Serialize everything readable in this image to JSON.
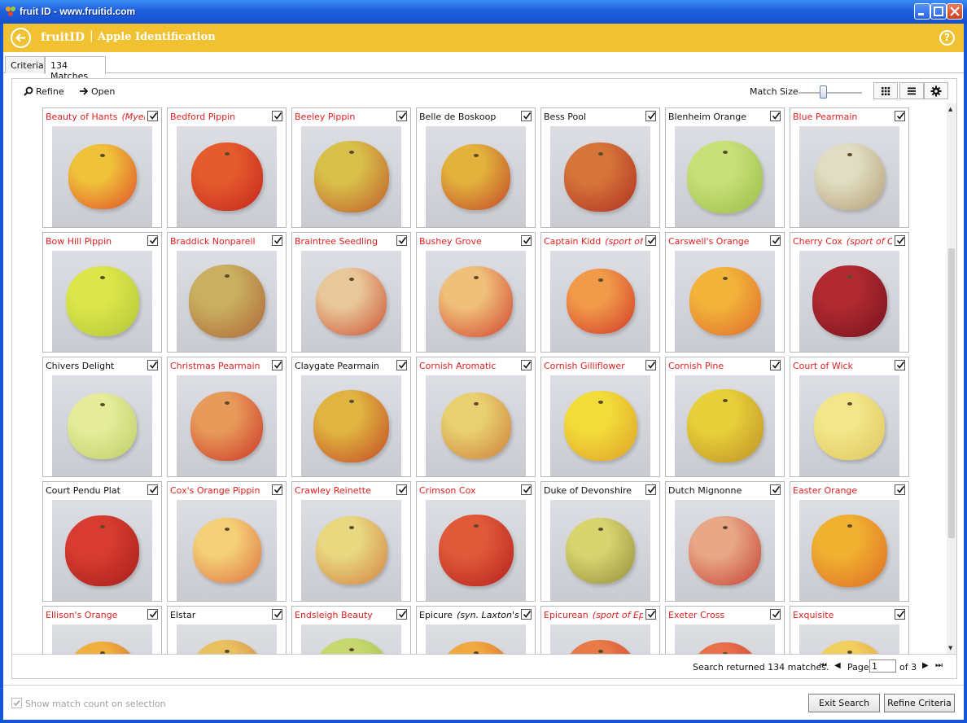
{
  "window": {
    "title": "fruit ID - www.fruitid.com",
    "min_icon": "minimize-icon",
    "max_icon": "maximize-icon",
    "close_icon": "close-icon"
  },
  "header": {
    "brand": "fruitID",
    "separator": "|",
    "subtitle": "Apple Identification",
    "help": "?",
    "back_icon": "back-arrow-icon"
  },
  "tabs": [
    {
      "label": "Criteria",
      "active": false
    },
    {
      "label": "134 Matches",
      "active": true
    }
  ],
  "toolbar": {
    "refine_label": "Refine",
    "open_label": "Open",
    "match_size_label": "Match Size",
    "match_size_level": 0.33,
    "view_icons": [
      "grid-view-icon",
      "list-view-icon",
      "settings-icon"
    ]
  },
  "colors": {
    "banner": "#f0c232",
    "match_red": "#e02020",
    "title_blue": "#1f5fdc"
  },
  "cards": [
    {
      "name": "Beauty of Hants",
      "note": "(Myers)",
      "red": true,
      "checked": true,
      "apple": [
        "#f0c23a",
        "#e0552a"
      ]
    },
    {
      "name": "Bedford Pippin",
      "note": "",
      "red": true,
      "checked": true,
      "apple": [
        "#e45c2d",
        "#c8281f"
      ]
    },
    {
      "name": "Beeley Pippin",
      "note": "",
      "red": true,
      "checked": true,
      "apple": [
        "#d8c04a",
        "#c2622e"
      ]
    },
    {
      "name": "Belle de Boskoop",
      "note": "",
      "red": false,
      "checked": true,
      "apple": [
        "#e2b23c",
        "#c44e2a"
      ]
    },
    {
      "name": "Bess Pool",
      "note": "",
      "red": false,
      "checked": true,
      "apple": [
        "#d6753a",
        "#b23424"
      ]
    },
    {
      "name": "Blenheim Orange",
      "note": "",
      "red": false,
      "checked": true,
      "apple": [
        "#c9e07a",
        "#9cc04a"
      ]
    },
    {
      "name": "Blue Pearmain",
      "note": "",
      "red": true,
      "checked": true,
      "apple": [
        "#e0ddc2",
        "#b8a37a"
      ]
    },
    {
      "name": "Bow Hill Pippin",
      "note": "",
      "red": true,
      "checked": true,
      "apple": [
        "#dce64a",
        "#b4c83a"
      ]
    },
    {
      "name": "Braddick Nonpareil",
      "note": "",
      "red": true,
      "checked": true,
      "apple": [
        "#c9b060",
        "#b06a3a"
      ]
    },
    {
      "name": "Braintree Seedling",
      "note": "",
      "red": true,
      "checked": true,
      "apple": [
        "#e8c89a",
        "#cf5a3a"
      ]
    },
    {
      "name": "Bushey Grove",
      "note": "",
      "red": true,
      "checked": true,
      "apple": [
        "#efc07a",
        "#d44a34"
      ]
    },
    {
      "name": "Captain Kidd",
      "note": "(sport of Kidd's O",
      "red": true,
      "checked": true,
      "apple": [
        "#f09a4a",
        "#d4402a"
      ]
    },
    {
      "name": "Carswell's Orange",
      "note": "",
      "red": true,
      "checked": true,
      "apple": [
        "#f2b43a",
        "#e07030"
      ]
    },
    {
      "name": "Cherry Cox",
      "note": "(sport of Cox's Or",
      "red": true,
      "checked": true,
      "apple": [
        "#b02a30",
        "#7a1420"
      ]
    },
    {
      "name": "Chivers Delight",
      "note": "",
      "red": false,
      "checked": true,
      "apple": [
        "#e4ec9a",
        "#c0d06a"
      ]
    },
    {
      "name": "Christmas Pearmain",
      "note": "",
      "red": true,
      "checked": true,
      "apple": [
        "#e89a5a",
        "#cc3c2a"
      ]
    },
    {
      "name": "Claygate Pearmain",
      "note": "",
      "red": false,
      "checked": true,
      "apple": [
        "#e0b440",
        "#c45028"
      ]
    },
    {
      "name": "Cornish Aromatic",
      "note": "",
      "red": true,
      "checked": true,
      "apple": [
        "#e8d070",
        "#d08440"
      ]
    },
    {
      "name": "Cornish Gilliflower",
      "note": "",
      "red": true,
      "checked": true,
      "apple": [
        "#f2dc3a",
        "#e0a428"
      ]
    },
    {
      "name": "Cornish Pine",
      "note": "",
      "red": true,
      "checked": true,
      "apple": [
        "#e8d03a",
        "#c09428"
      ]
    },
    {
      "name": "Court of Wick",
      "note": "",
      "red": true,
      "checked": true,
      "apple": [
        "#f2e68a",
        "#e0c860"
      ]
    },
    {
      "name": "Court Pendu Plat",
      "note": "",
      "red": false,
      "checked": true,
      "apple": [
        "#d83c30",
        "#a8201c"
      ]
    },
    {
      "name": "Cox's Orange Pippin",
      "note": "",
      "red": true,
      "checked": true,
      "apple": [
        "#f4d078",
        "#e07a44"
      ]
    },
    {
      "name": "Crawley Reinette",
      "note": "",
      "red": true,
      "checked": true,
      "apple": [
        "#e8d880",
        "#d48848"
      ]
    },
    {
      "name": "Crimson Cox",
      "note": "",
      "red": true,
      "checked": true,
      "apple": [
        "#e05a3a",
        "#b82420"
      ]
    },
    {
      "name": "Duke of Devonshire",
      "note": "",
      "red": false,
      "checked": true,
      "apple": [
        "#d8d470",
        "#9a9440"
      ]
    },
    {
      "name": "Dutch Mignonne",
      "note": "",
      "red": false,
      "checked": true,
      "apple": [
        "#e8a888",
        "#c8483a"
      ]
    },
    {
      "name": "Easter Orange",
      "note": "",
      "red": true,
      "checked": true,
      "apple": [
        "#f0b030",
        "#e07028"
      ]
    },
    {
      "name": "Ellison's Orange",
      "note": "",
      "red": true,
      "checked": true,
      "apple": [
        "#f0b040",
        "#d06030"
      ]
    },
    {
      "name": "Elstar",
      "note": "",
      "red": false,
      "checked": true,
      "apple": [
        "#e8c060",
        "#d07a40"
      ]
    },
    {
      "name": "Endsleigh Beauty",
      "note": "",
      "red": true,
      "checked": true,
      "apple": [
        "#c8d870",
        "#9cbc48"
      ]
    },
    {
      "name": "Epicure",
      "note": "(syn. Laxton's Epicu",
      "red": false,
      "checked": true,
      "apple": [
        "#f0a840",
        "#d85a30"
      ]
    },
    {
      "name": "Epicurean",
      "note": "(sport of Epicure)",
      "red": true,
      "checked": true,
      "apple": [
        "#e87a48",
        "#cc3a2a"
      ]
    },
    {
      "name": "Exeter Cross",
      "note": "",
      "red": true,
      "checked": true,
      "apple": [
        "#e8704a",
        "#c83a2a"
      ]
    },
    {
      "name": "Exquisite",
      "note": "",
      "red": true,
      "checked": true,
      "apple": [
        "#f2d060",
        "#e09440"
      ]
    }
  ],
  "footer": {
    "search_text": "Search returned 134 matches.",
    "page_label": "Page",
    "page_value": "1",
    "of_label": "of 3"
  },
  "bottom": {
    "show_count_label": "Show match count on selection",
    "exit_button": "Exit Search",
    "refine_button": "Refine Criteria"
  }
}
